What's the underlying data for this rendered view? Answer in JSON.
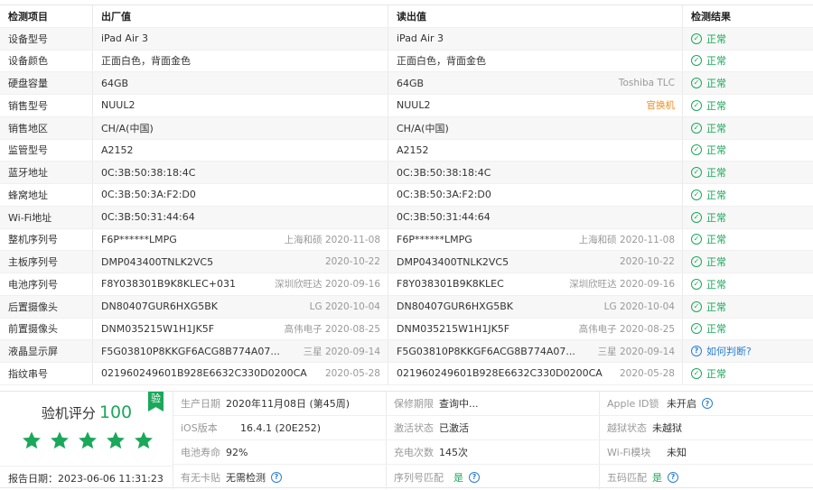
{
  "headers": [
    "检测项目",
    "出厂值",
    "读出值",
    "检测结果"
  ],
  "rows": [
    {
      "item": "设备型号",
      "factory": "iPad Air 3",
      "factory_note": "",
      "read": "iPad Air 3",
      "read_note": "",
      "read_note_style": "",
      "result": "正常",
      "result_kind": "ok"
    },
    {
      "item": "设备颜色",
      "factory": "正面白色，背面金色",
      "factory_note": "",
      "read": "正面白色，背面金色",
      "read_note": "",
      "read_note_style": "",
      "result": "正常",
      "result_kind": "ok"
    },
    {
      "item": "硬盘容量",
      "factory": "64GB",
      "factory_note": "",
      "read": "64GB",
      "read_note": "Toshiba TLC",
      "read_note_style": "",
      "result": "正常",
      "result_kind": "ok"
    },
    {
      "item": "销售型号",
      "factory": "NUUL2",
      "factory_note": "",
      "read": "NUUL2",
      "read_note": "官换机",
      "read_note_style": "warn",
      "result": "正常",
      "result_kind": "ok"
    },
    {
      "item": "销售地区",
      "factory": "CH/A(中国)",
      "factory_note": "",
      "read": "CH/A(中国)",
      "read_note": "",
      "read_note_style": "",
      "result": "正常",
      "result_kind": "ok"
    },
    {
      "item": "监管型号",
      "factory": "A2152",
      "factory_note": "",
      "read": "A2152",
      "read_note": "",
      "read_note_style": "",
      "result": "正常",
      "result_kind": "ok"
    },
    {
      "item": "蓝牙地址",
      "factory": "0C:3B:50:38:18:4C",
      "factory_note": "",
      "read": "0C:3B:50:38:18:4C",
      "read_note": "",
      "read_note_style": "",
      "result": "正常",
      "result_kind": "ok"
    },
    {
      "item": "蜂窝地址",
      "factory": "0C:3B:50:3A:F2:D0",
      "factory_note": "",
      "read": "0C:3B:50:3A:F2:D0",
      "read_note": "",
      "read_note_style": "",
      "result": "正常",
      "result_kind": "ok"
    },
    {
      "item": "Wi-Fi地址",
      "factory": "0C:3B:50:31:44:64",
      "factory_note": "",
      "read": "0C:3B:50:31:44:64",
      "read_note": "",
      "read_note_style": "",
      "result": "正常",
      "result_kind": "ok"
    },
    {
      "item": "整机序列号",
      "factory": "F6P******LMPG",
      "factory_note": "上海和硕 2020-11-08",
      "read": "F6P******LMPG",
      "read_note": "上海和硕 2020-11-08",
      "read_note_style": "",
      "result": "正常",
      "result_kind": "ok"
    },
    {
      "item": "主板序列号",
      "factory": "DMP043400TNLK2VC5",
      "factory_note": "2020-10-22",
      "read": "DMP043400TNLK2VC5",
      "read_note": "2020-10-22",
      "read_note_style": "",
      "result": "正常",
      "result_kind": "ok"
    },
    {
      "item": "电池序列号",
      "factory": "F8Y038301B9K8KLEC+031",
      "factory_note": "深圳欣旺达 2020-09-16",
      "read": "F8Y038301B9K8KLEC",
      "read_note": "深圳欣旺达 2020-09-16",
      "read_note_style": "",
      "result": "正常",
      "result_kind": "ok"
    },
    {
      "item": "后置摄像头",
      "factory": "DN80407GUR6HXG5BK",
      "factory_note": "LG 2020-10-04",
      "read": "DN80407GUR6HXG5BK",
      "read_note": "LG 2020-10-04",
      "read_note_style": "",
      "result": "正常",
      "result_kind": "ok"
    },
    {
      "item": "前置摄像头",
      "factory": "DNM035215W1H1JK5F",
      "factory_note": "高伟电子 2020-08-25",
      "read": "DNM035215W1H1JK5F",
      "read_note": "高伟电子 2020-08-25",
      "read_note_style": "",
      "result": "正常",
      "result_kind": "ok"
    },
    {
      "item": "液晶显示屏",
      "factory": "F5G03810P8KKGF6ACG8B774A07...",
      "factory_note": "三星 2020-09-14",
      "read": "F5G03810P8KKGF6ACG8B774A07...",
      "read_note": "三星 2020-09-14",
      "read_note_style": "",
      "result": "如何判断?",
      "result_kind": "question"
    },
    {
      "item": "指纹串号",
      "factory": "021960249601B928E6632C330D0200CA",
      "factory_note": "2020-05-28",
      "read": "021960249601B928E6632C330D0200CA",
      "read_note": "2020-05-28",
      "read_note_style": "",
      "result": "正常",
      "result_kind": "ok"
    }
  ],
  "summary": {
    "score_label": "验机评分",
    "score": "100",
    "badge": "验",
    "stars": 5,
    "report_date": "报告日期：2023-06-06 11:31:23",
    "colors": {
      "ok": "#1aa85a",
      "question": "#2a7fd4",
      "warn": "#f08c1e"
    }
  },
  "details": [
    [
      {
        "label": "生产日期",
        "value": "2020年11月08日 (第45周)",
        "help": false,
        "ok": false
      },
      {
        "label": "保修期限",
        "value": "查询中...",
        "help": false,
        "ok": false
      },
      {
        "label": "Apple ID锁",
        "value": "未开启",
        "help": true,
        "ok": false
      }
    ],
    [
      {
        "label": "iOS版本",
        "value": "16.4.1 (20E252)",
        "help": false,
        "ok": false
      },
      {
        "label": "激活状态",
        "value": "已激活",
        "help": false,
        "ok": false
      },
      {
        "label": "越狱状态",
        "value": "未越狱",
        "help": false,
        "ok": false
      }
    ],
    [
      {
        "label": "电池寿命",
        "value": "92%",
        "help": false,
        "ok": false
      },
      {
        "label": "充电次数",
        "value": "145次",
        "help": false,
        "ok": false
      },
      {
        "label": "Wi-Fi模块",
        "value": "未知",
        "help": false,
        "ok": false
      }
    ],
    [
      {
        "label": "有无卡贴",
        "value": "无需检测",
        "help": true,
        "ok": false
      },
      {
        "label": "序列号匹配",
        "value": "是",
        "help": true,
        "ok": true
      },
      {
        "label": "五码匹配",
        "value": "是",
        "help": true,
        "ok": true
      }
    ]
  ]
}
